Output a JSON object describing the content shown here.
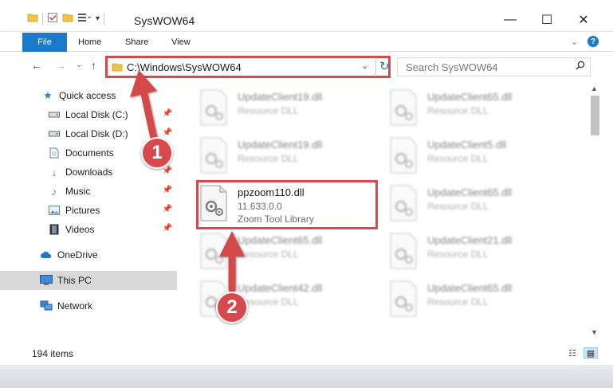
{
  "window": {
    "title": "SysWOW64",
    "minimize_glyph": "—",
    "maximize_glyph": "☐",
    "close_glyph": "✕"
  },
  "ribbon": {
    "file_tab": "File",
    "tabs": [
      "Home",
      "Share",
      "View"
    ],
    "help_glyph": "?"
  },
  "address": {
    "path": "C:\\Windows\\SysWOW64",
    "search_placeholder": "Search SysWOW64"
  },
  "nav": {
    "items": [
      {
        "label": "Quick access",
        "icon": "star-icon"
      },
      {
        "label": "Local Disk (C:)",
        "icon": "drive-icon",
        "pinned": true
      },
      {
        "label": "Local Disk (D:)",
        "icon": "drive-icon",
        "pinned": true
      },
      {
        "label": "Documents",
        "icon": "documents-icon",
        "pinned": true
      },
      {
        "label": "Downloads",
        "icon": "download-icon",
        "pinned": true
      },
      {
        "label": "Music",
        "icon": "music-icon",
        "pinned": true
      },
      {
        "label": "Pictures",
        "icon": "pictures-icon",
        "pinned": true
      },
      {
        "label": "Videos",
        "icon": "videos-icon",
        "pinned": true
      },
      {
        "label": "OneDrive",
        "icon": "cloud-icon"
      },
      {
        "label": "This PC",
        "icon": "computer-icon",
        "selected": true
      },
      {
        "label": "Network",
        "icon": "network-icon"
      }
    ]
  },
  "files": {
    "left": [
      {
        "name": "UpdateClient19.dll",
        "type": "Resource DLL"
      },
      {
        "name": "UpdateClient19.dll",
        "type": "Resource DLL"
      },
      {
        "name": "ppzoom110.dll",
        "version": "11.633.0.0",
        "description": "Zoom Tool Library"
      },
      {
        "name": "UpdateClient65.dll",
        "type": "Resource DLL"
      },
      {
        "name": "UpdateClient42.dll",
        "type": "Resource DLL"
      }
    ],
    "right": [
      {
        "name": "UpdateClient65.dll",
        "type": "Resource DLL"
      },
      {
        "name": "UpdateClient5.dll",
        "type": "Resource DLL"
      },
      {
        "name": "UpdateClient65.dll",
        "type": "Resource DLL"
      },
      {
        "name": "UpdateClient21.dll",
        "type": "Resource DLL"
      },
      {
        "name": "UpdateClient65.dll",
        "type": "Resource DLL"
      }
    ]
  },
  "status": {
    "item_count": "194 items"
  },
  "callouts": [
    "1",
    "2"
  ],
  "colors": {
    "accent": "#1979ca",
    "annotation_red": "#d6494c"
  }
}
